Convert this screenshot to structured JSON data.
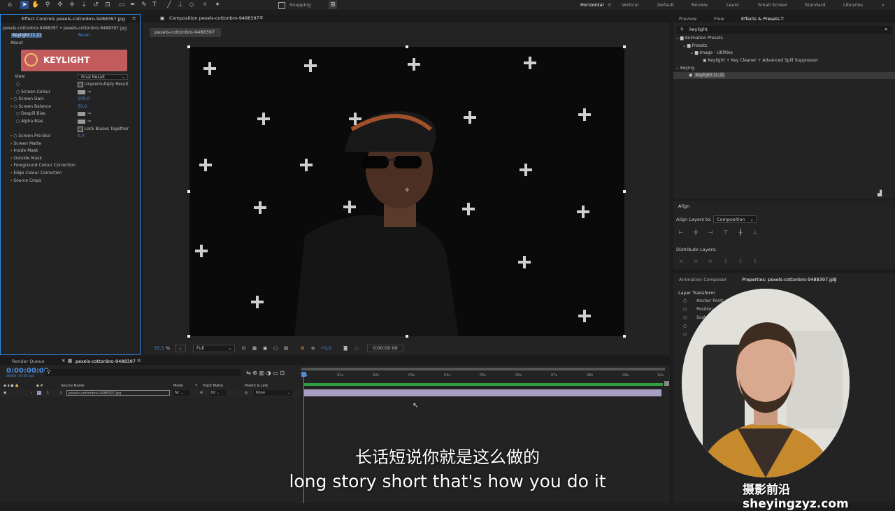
{
  "workspaces": [
    "Horizontal",
    "Vertical",
    "Default",
    "Review",
    "Learn",
    "Small Screen",
    "Standard",
    "Libraries"
  ],
  "snapping": "Snapping",
  "effect_controls": {
    "tab": "Effect Controls pexels-cottonbro-9488397.jpg",
    "path": "pexels-cottonbro-9488397 • pexels-cottonbro-9488397.jpg",
    "fx_name": "Keylight (1.2)",
    "reset": "Reset",
    "about": "About",
    "logo": "KEYLIGHT",
    "view_label": "View",
    "view_value": "Final Result",
    "unpremultiply": "Unpremultiply Result",
    "screen_colour": "Screen Colour",
    "screen_gain": "Screen Gain",
    "screen_gain_val": "100,0",
    "screen_balance": "Screen Balance",
    "screen_balance_val": "50,0",
    "despill_bias": "Despill Bias",
    "alpha_bias": "Alpha Bias",
    "lock_biases": "Lock Biases Together",
    "screen_preblur": "Screen Pre-blur",
    "screen_preblur_val": "0,0",
    "groups": [
      "Screen Matte",
      "Inside Mask",
      "Outside Mask",
      "Foreground Colour Correction",
      "Edge Colour Correction",
      "Source Crops"
    ]
  },
  "composition": {
    "tab": "Composition pexels-cottonbro-9488397",
    "subtab": "pexels-cottonbro-9488397",
    "zoom": "33,3",
    "zoom_unit": "%",
    "quality": "Full",
    "timecode": "0:00:00:00",
    "exposure": "+0,0"
  },
  "effects_presets": {
    "tabs": [
      "Preview",
      "Flow",
      "Effects & Presets"
    ],
    "search": "keylight",
    "tree": [
      {
        "label": "Animation Presets",
        "level": 0
      },
      {
        "label": "Presets",
        "level": 1
      },
      {
        "label": "Image - Utilities",
        "level": 2
      },
      {
        "label": "Keylight + Key Cleaner + Advanced Spill Suppressor",
        "level": 3
      },
      {
        "label": "Keying",
        "level": 0
      },
      {
        "label": "Keylight (1.2)",
        "level": 1
      }
    ]
  },
  "align": {
    "title": "Align",
    "align_to_label": "Align Layers to:",
    "align_to_value": "Composition",
    "distribute": "Distribute Layers:"
  },
  "properties": {
    "tabs": [
      "Animation Composer",
      "Properties: pexels-cottonbro-9488397.jpg"
    ],
    "section": "Layer Transform",
    "items": [
      "Anchor Point",
      "Position",
      "Scale"
    ]
  },
  "timeline": {
    "tabs": [
      "Render Queue",
      "pexels-cottonbro-9488397"
    ],
    "timecode": "0:00:00:00",
    "timecode_sub": "00000 (30.00 fps)",
    "cols": {
      "source": "Source Name",
      "mode": "Mode",
      "t": "T",
      "track_matte": "Track Matte",
      "parent": "Parent & Link"
    },
    "layer": {
      "num": "1",
      "name": "pexels-cottonbro-9488397.jpg",
      "mode": "Nc",
      "matte": "Nc",
      "parent": "None"
    },
    "ruler": [
      "0s",
      "01s",
      "02s",
      "03s",
      "04s",
      "05s",
      "06s",
      "07s",
      "08s",
      "09s",
      "10s"
    ]
  },
  "subtitles": {
    "zh": "长话短说你就是这么做的",
    "en": "long story short that's how you do it"
  },
  "watermark": "摄影前沿 sheyingzyz.com",
  "colors": {
    "accent": "#2d8ceb",
    "selection": "#2d4f8e",
    "logo_bg": "#c25c5c",
    "layer_bar": "#a99ec4"
  }
}
